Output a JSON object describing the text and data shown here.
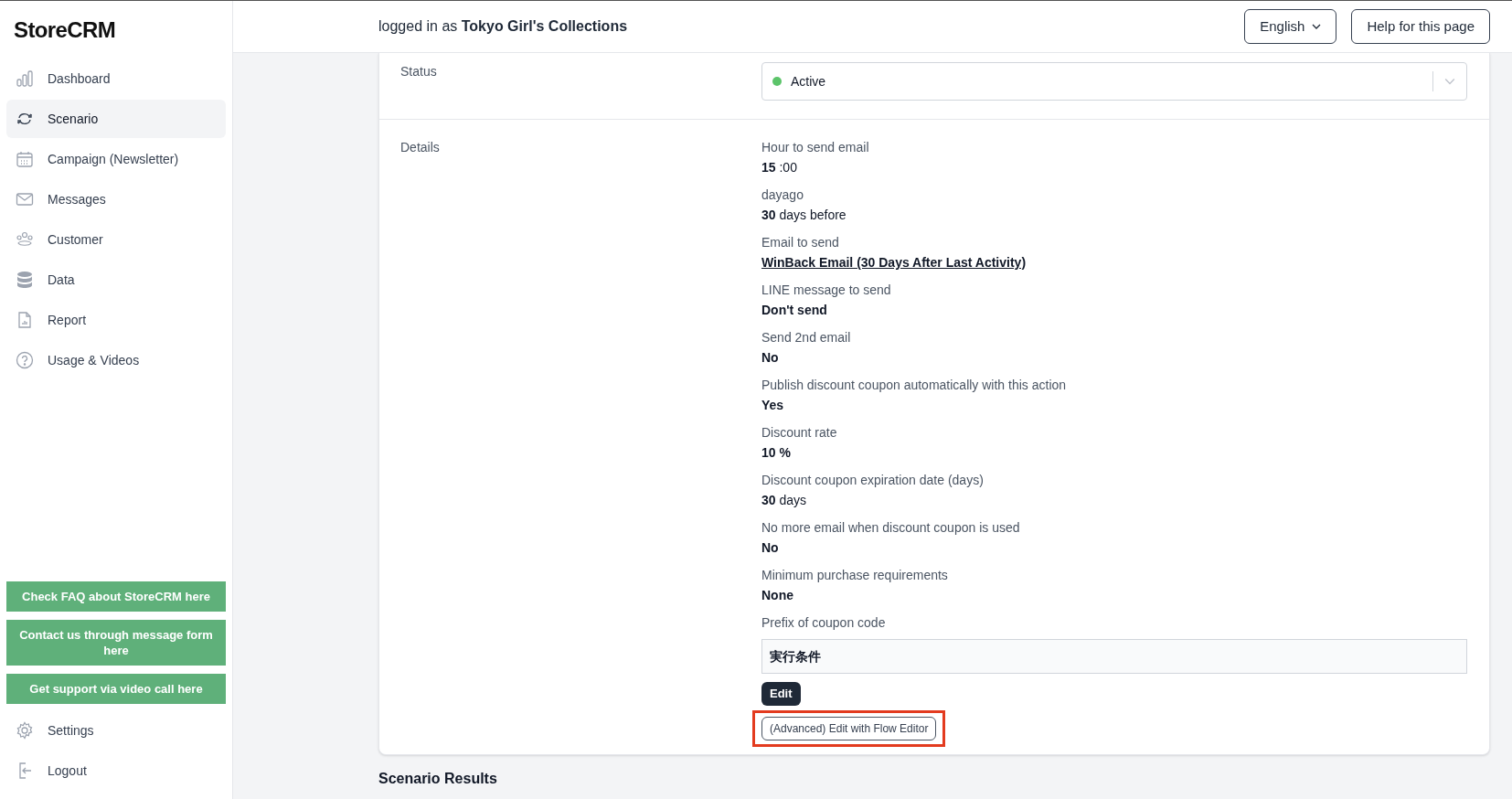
{
  "sidebar": {
    "logo": "StoreCRM",
    "items": [
      {
        "label": "Dashboard",
        "selected": false
      },
      {
        "label": "Scenario",
        "selected": true
      },
      {
        "label": "Campaign (Newsletter)",
        "selected": false
      },
      {
        "label": "Messages",
        "selected": false
      },
      {
        "label": "Customer",
        "selected": false
      },
      {
        "label": "Data",
        "selected": false
      },
      {
        "label": "Report",
        "selected": false
      },
      {
        "label": "Usage & Videos",
        "selected": false
      }
    ],
    "support_buttons": [
      "Check FAQ about StoreCRM here",
      "Contact us through message form here",
      "Get support via video call here"
    ],
    "footer_items": [
      {
        "label": "Settings"
      },
      {
        "label": "Logout"
      }
    ]
  },
  "header": {
    "login_text": "logged in as **Tokyo Girl's Collections**",
    "language": "English",
    "help_button": "Help for this page"
  },
  "status": {
    "label": "Status",
    "value": "Active",
    "color": "#5cc46a"
  },
  "details": {
    "label": "Details",
    "fields": [
      {
        "label": "Hour to send email",
        "value": "**15** :00",
        "kind": "text",
        "bold": false
      },
      {
        "label": "dayago",
        "value": "**30** days before",
        "kind": "text",
        "bold": false
      },
      {
        "label": "Email to send",
        "value": "WinBack Email (30 Days After Last Activity)",
        "kind": "link",
        "bold": true
      },
      {
        "label": "LINE message to send",
        "value": "Don't send",
        "kind": "text",
        "bold": true
      },
      {
        "label": "Send 2nd email",
        "value": "No",
        "kind": "text",
        "bold": true
      },
      {
        "label": "Publish discount coupon automatically with this action",
        "value": "Yes",
        "kind": "text",
        "bold": true
      },
      {
        "label": "Discount rate",
        "value": "10 %",
        "kind": "text",
        "bold": true
      },
      {
        "label": "Discount coupon expiration date (days)",
        "value": "**30** days",
        "kind": "text",
        "bold": false
      },
      {
        "label": "No more email when discount coupon is used",
        "value": "No",
        "kind": "text",
        "bold": true
      },
      {
        "label": "Minimum purchase requirements",
        "value": "None",
        "kind": "text",
        "bold": true
      }
    ],
    "coupon_prefix": {
      "label": "Prefix of coupon code",
      "value": "実行条件"
    },
    "edit_button": "Edit",
    "flow_editor_button": {
      "label": "(Advanced) Edit with Flow Editor",
      "highlighted": true
    }
  },
  "section_title": "Scenario Results"
}
